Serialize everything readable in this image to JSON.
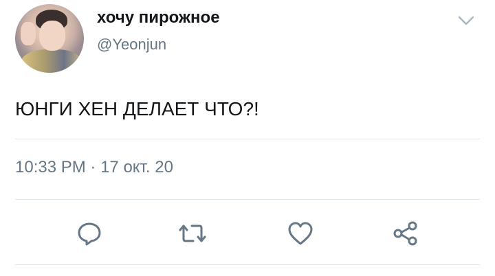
{
  "tweet": {
    "display_name": "хочу пирожное",
    "handle": "@Yeonjun",
    "text": "ЮНГИ ХЕН ДЕЛАЕТ ЧТО?!",
    "time": "10:33 PM",
    "separator": "·",
    "date": "17 окт. 20"
  },
  "icons": {
    "menu": "chevron-down-icon",
    "reply": "reply-icon",
    "retweet": "retweet-icon",
    "like": "heart-icon",
    "share": "share-icon"
  },
  "colors": {
    "text": "#14171a",
    "secondary": "#657786",
    "icon": "#657786",
    "divider": "#e1e8ed"
  }
}
